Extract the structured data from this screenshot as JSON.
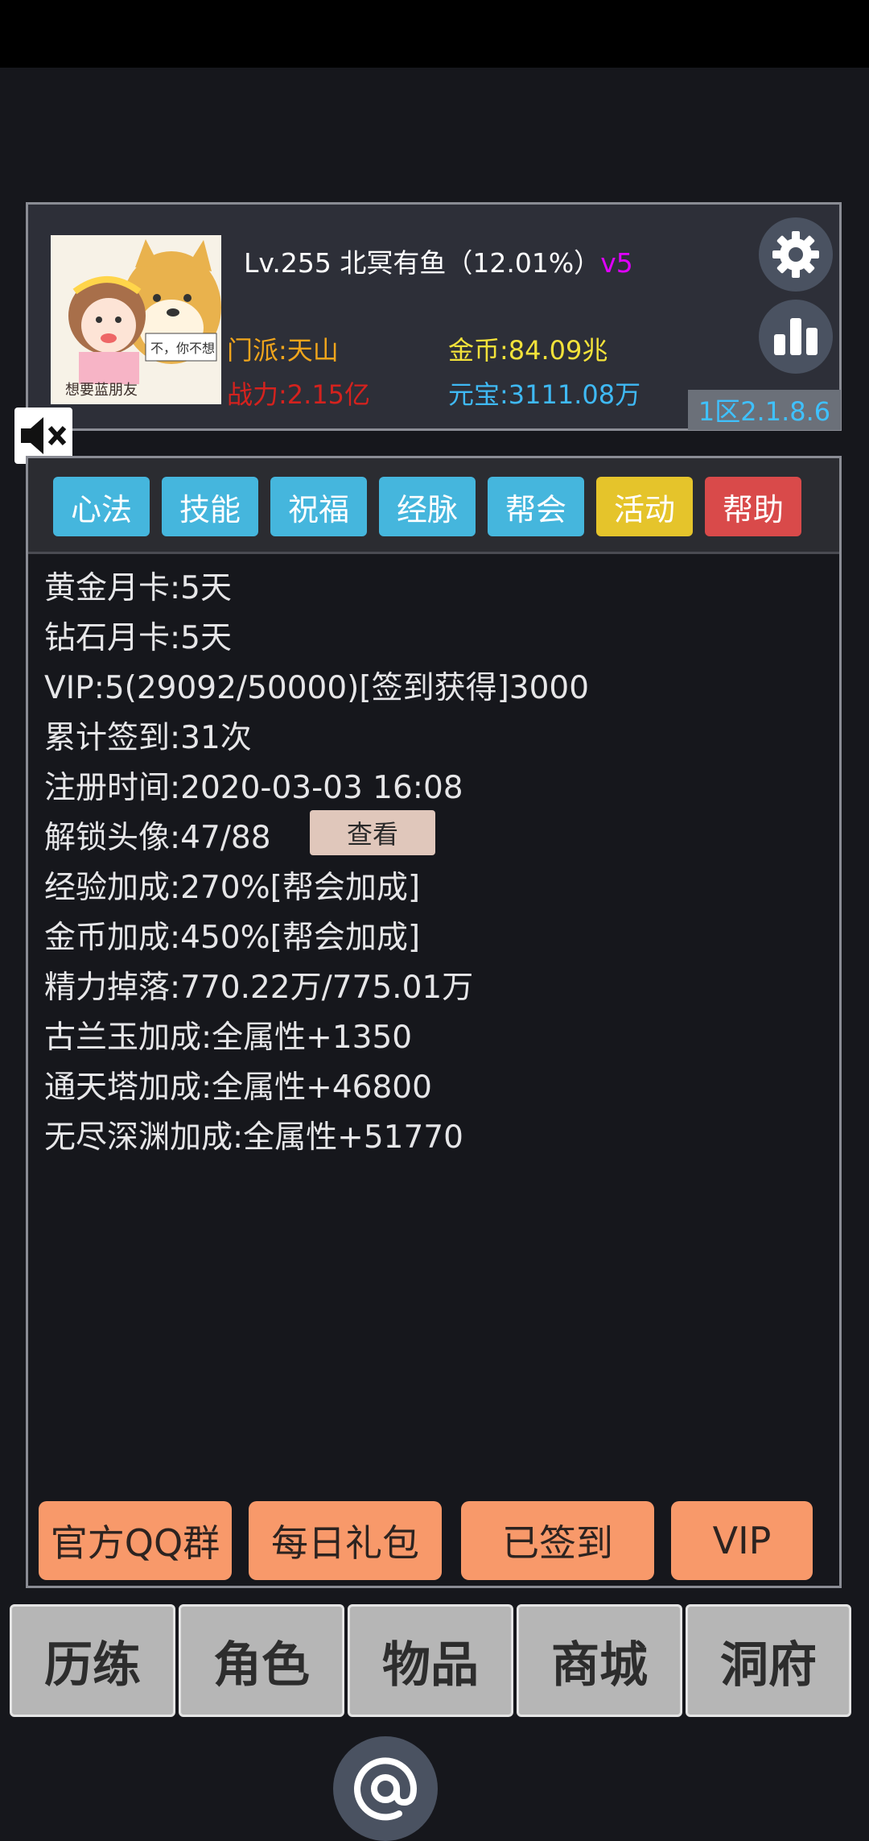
{
  "profile": {
    "level": "Lv.255",
    "name": "北冥有鱼",
    "exp_percent": "（12.01%）",
    "vip_tag": "v5",
    "sect": "门派:天山",
    "power": "战力:2.15亿",
    "gold": "金币:84.09兆",
    "yuanbao": "元宝:3111.08万",
    "server": "1区2.1.8.6",
    "avatar_caption": "想要蓝朋友",
    "avatar_bubble": "不，你不想"
  },
  "tabs": [
    {
      "label": "心法",
      "color": "#45b6dd"
    },
    {
      "label": "技能",
      "color": "#45b6dd"
    },
    {
      "label": "祝福",
      "color": "#45b6dd"
    },
    {
      "label": "经脉",
      "color": "#45b6dd"
    },
    {
      "label": "帮会",
      "color": "#45b6dd"
    },
    {
      "label": "活动",
      "color": "#e5c42b"
    },
    {
      "label": "帮助",
      "color": "#d94a4a"
    }
  ],
  "info_lines": [
    "黄金月卡:5天",
    "钻石月卡:5天",
    "VIP:5(29092/50000)[签到获得]3000",
    "累计签到:31次",
    "注册时间:2020-03-03 16:08",
    "解锁头像:47/88",
    "经验加成:270%[帮会加成]",
    "金币加成:450%[帮会加成]",
    "精力掉落:770.22万/775.01万",
    "古兰玉加成:全属性+1350",
    "通天塔加成:全属性+46800",
    "无尽深渊加成:全属性+51770"
  ],
  "view_button": "查看",
  "actions": [
    "官方QQ群",
    "每日礼包",
    "已签到",
    "VIP"
  ],
  "bottom_nav": [
    "历练",
    "角色",
    "物品",
    "商城",
    "洞府"
  ],
  "icons": {
    "settings": "gear-icon",
    "stats": "bar-chart-icon",
    "mute": "speaker-mute-icon",
    "at": "at-icon"
  }
}
